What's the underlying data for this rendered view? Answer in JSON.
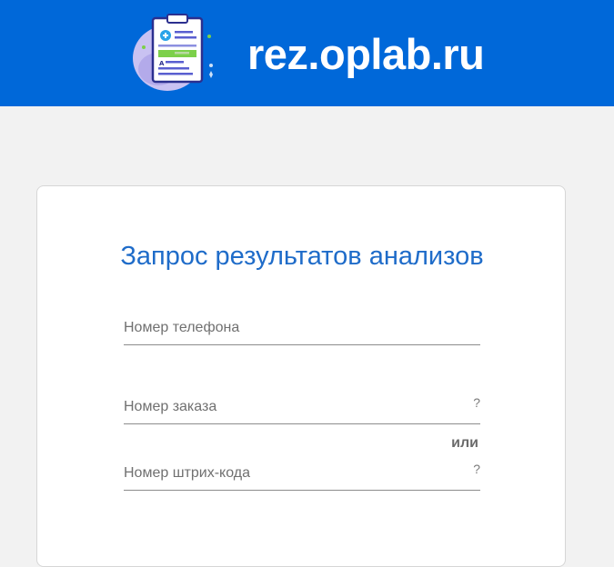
{
  "header": {
    "site_title": "rez.oplab.ru",
    "logo_icon": "clipboard-medical-report-icon",
    "background_color": "#0068d9"
  },
  "form": {
    "title": "Запрос результатов анализов",
    "title_color": "#1f6cc9",
    "phone_field": {
      "placeholder": "Номер телефона",
      "value": ""
    },
    "order_field": {
      "placeholder": "Номер заказа",
      "value": "",
      "help": "?"
    },
    "or_label": "или",
    "barcode_field": {
      "placeholder": "Номер штрих-кода",
      "value": "",
      "help": "?"
    }
  }
}
